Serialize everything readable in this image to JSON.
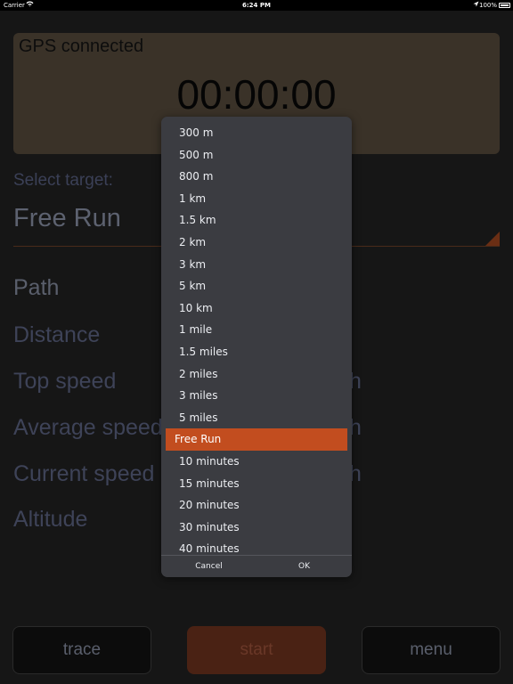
{
  "status_bar": {
    "carrier": "Carrier",
    "time": "6:24 PM",
    "battery": "100%"
  },
  "gps": {
    "status": "GPS connected",
    "timer": "00:00:00"
  },
  "target": {
    "label": "Select target:",
    "value": "Free Run"
  },
  "stats": {
    "path": "Path",
    "distance": "Distance",
    "top_speed": "Top speed",
    "average_speed": "Average speed",
    "current_speed": "Current speed",
    "altitude": "Altitude",
    "unit_fragment": "h"
  },
  "buttons": {
    "trace": "trace",
    "start": "start",
    "menu": "menu"
  },
  "picker": {
    "options": [
      "300 m",
      "500 m",
      "800 m",
      "1 km",
      "1.5 km",
      "2 km",
      "3 km",
      "5 km",
      "10 km",
      "1 mile",
      "1.5 miles",
      "2 miles",
      "3 miles",
      "5 miles",
      "Free Run",
      "10 minutes",
      "15 minutes",
      "20 minutes",
      "30 minutes",
      "40 minutes"
    ],
    "selected": "Free Run",
    "cancel_label": "Cancel",
    "ok_label": "OK"
  },
  "colors": {
    "accent": "#c24d1f",
    "panel": "#3a3228",
    "background": "#161616"
  }
}
